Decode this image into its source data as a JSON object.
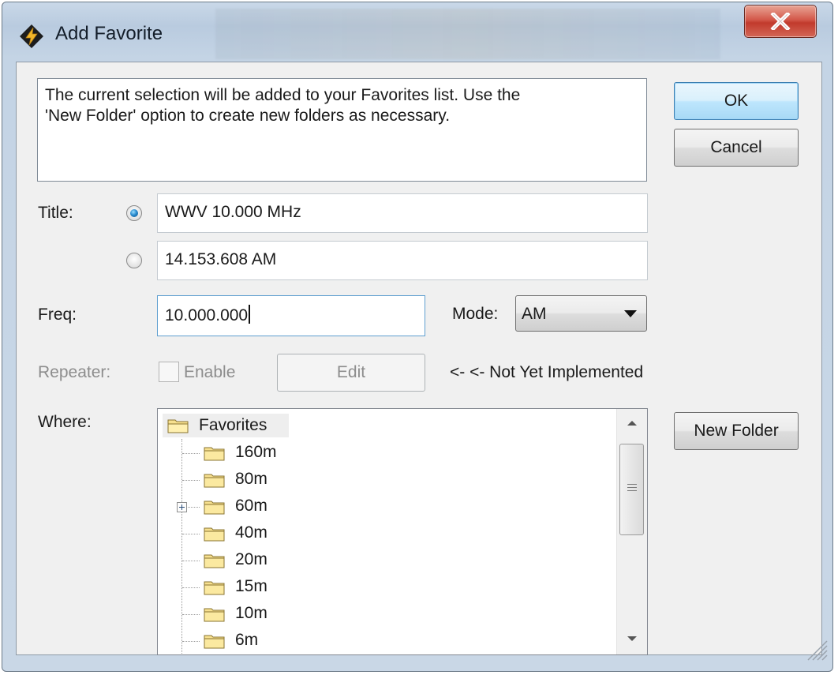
{
  "window": {
    "title": "Add Favorite"
  },
  "description": "The current selection will be added to your Favorites list. Use the\n'New Folder' option to create new folders as necessary.",
  "buttons": {
    "ok": "OK",
    "cancel": "Cancel",
    "edit": "Edit",
    "new_folder": "New Folder"
  },
  "title_row": {
    "label": "Title:",
    "options": [
      {
        "value": "WWV 10.000 MHz",
        "selected": true
      },
      {
        "value": "14.153.608 AM",
        "selected": false
      }
    ]
  },
  "freq": {
    "label": "Freq:",
    "value": "10.000.000"
  },
  "mode": {
    "label": "Mode:",
    "value": "AM"
  },
  "repeater": {
    "label": "Repeater:",
    "enable_label": "Enable",
    "enabled": false,
    "note": "<- <- Not Yet Implemented"
  },
  "where": {
    "label": "Where:",
    "root": "Favorites",
    "folders": [
      "160m",
      "80m",
      "60m",
      "40m",
      "20m",
      "15m",
      "10m",
      "6m"
    ],
    "expandable": [
      "60m"
    ]
  },
  "icons": {
    "app": "lightning-diamond-icon",
    "close": "close-icon",
    "folder": "folder-icon",
    "expander": "plus-expander-icon"
  },
  "colors": {
    "accent": "#3c7fb1",
    "close": "#c9473a",
    "radio_selected": "#2a8ccf"
  }
}
